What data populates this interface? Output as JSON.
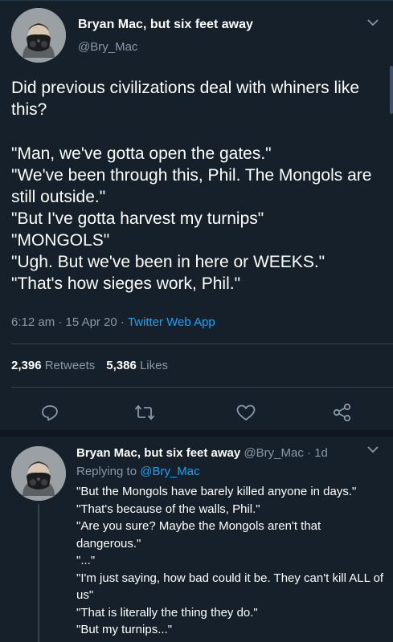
{
  "main_tweet": {
    "author_name": "Bryan Mac, but six feet away",
    "handle": "@Bry_Mac",
    "text_lines": [
      "Did previous civilizations deal with whiners like this?",
      "\"Man, we've gotta open the gates.\"",
      "\"We've been through this, Phil. The Mongols are still outside.\"",
      "\"But I've gotta harvest my turnips\"",
      "\"MONGOLS\"",
      "\"Ugh. But we've been in here or WEEKS.\"",
      "\"That's how sieges work, Phil.\""
    ],
    "time": "6:12 am",
    "separator": " · ",
    "date": "15 Apr 20",
    "source": "Twitter Web App",
    "retweet_count": "2,396",
    "retweet_label": "Retweets",
    "like_count": "5,386",
    "like_label": "Likes"
  },
  "reply_tweet": {
    "author_name": "Bryan Mac, but six feet away",
    "handle": "@Bry_Mac",
    "age": "1d",
    "replying_prefix": "Replying to ",
    "replying_handle": "@Bry_Mac",
    "text_lines": [
      "\"But the Mongols have barely killed anyone in days.\"",
      "\"That's because of the walls, Phil.\"",
      "\"Are you sure? Maybe the Mongols aren't that dangerous.\"",
      "\"...\"",
      "\"I'm just saying, how bad could it be. They can't kill ALL of us\"",
      "\"That is literally the thing they do.\"",
      "\"But my turnips...\""
    ]
  },
  "actions": {
    "reply_icon": "reply-icon",
    "retweet_icon": "retweet-icon",
    "like_icon": "heart-icon",
    "share_icon": "share-icon"
  },
  "colors": {
    "background": "#15202b",
    "text": "#ffffff",
    "secondary": "#8899a6",
    "link": "#1da1f2",
    "divider": "#38444d"
  }
}
